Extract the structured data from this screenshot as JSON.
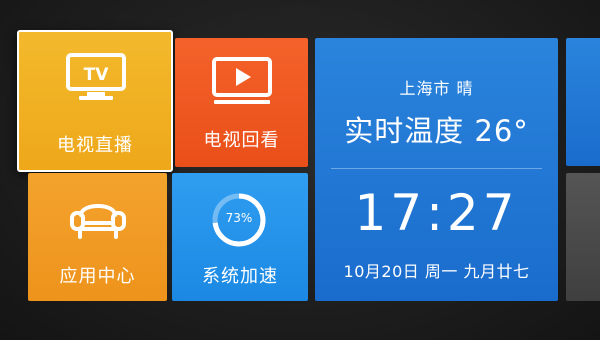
{
  "tiles": {
    "live_tv": {
      "label": "电视直播",
      "icon": "tv-icon",
      "icon_text": "TV",
      "color": "#f0ad20"
    },
    "tv_replay": {
      "label": "电视回看",
      "icon": "play-screen-icon",
      "color": "#ef5a22"
    },
    "app_center": {
      "label": "应用中心",
      "icon": "sofa-icon",
      "color": "#f09a22"
    },
    "system_speedup": {
      "label": "系统加速",
      "icon": "progress-ring-icon",
      "percent_text": "73%",
      "percent_value": 73,
      "color": "#2593ea"
    },
    "weather": {
      "city_weather": "上海市  晴",
      "temp_line": "实时温度 26°",
      "time": "17:27",
      "date_line": "10月20日 周一 九月廿七",
      "color": "#2278d6"
    }
  }
}
